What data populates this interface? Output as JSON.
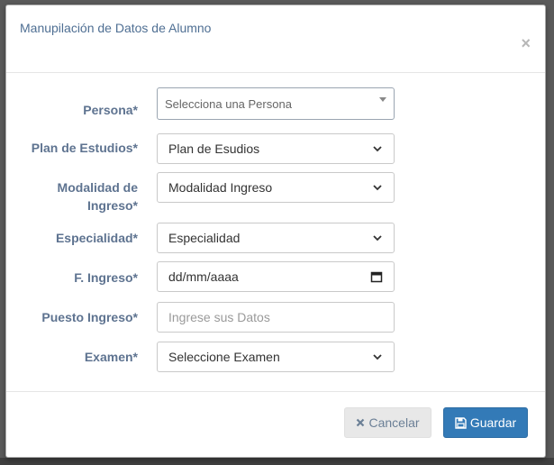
{
  "modal": {
    "title": "Manupilación de Datos de Alumno",
    "close_glyph": "×"
  },
  "form": {
    "persona": {
      "label": "Persona*",
      "placeholder": "Selecciona una Persona"
    },
    "plan": {
      "label": "Plan de Estudios*",
      "value": "Plan de Esudios"
    },
    "modalidad": {
      "label_line1": "Modalidad de",
      "label_line2": "Ingreso*",
      "value": "Modalidad Ingreso"
    },
    "especialidad": {
      "label": "Especialidad*",
      "value": "Especialidad"
    },
    "ingreso": {
      "label": "F. Ingreso*",
      "value": "dd/mm/aaaa"
    },
    "puesto": {
      "label": "Puesto Ingreso*",
      "placeholder": "Ingrese sus Datos"
    },
    "examen": {
      "label": "Examen*",
      "value": "Seleccione Examen"
    }
  },
  "footer": {
    "cancel_label": "Cancelar",
    "save_label": "Guardar"
  },
  "colors": {
    "label": "#5e7390",
    "title": "#4f6f93",
    "primary": "#337ab7",
    "cancel_bg": "#e8e8e8"
  },
  "icons": {
    "close": "close-icon",
    "chevron": "chevron-down-icon",
    "calendar": "calendar-icon",
    "cancel": "times-icon",
    "save": "floppy-disk-icon"
  }
}
